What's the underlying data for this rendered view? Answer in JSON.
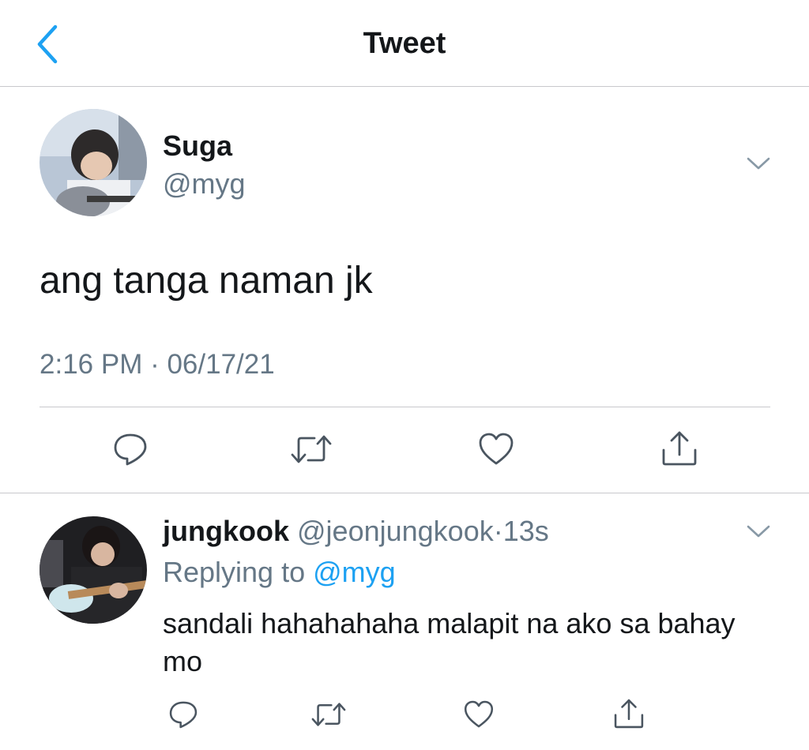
{
  "nav": {
    "title": "Tweet",
    "back_icon": "chevron-left-icon",
    "accent": "#1da1f2"
  },
  "tweet": {
    "author_name": "Suga",
    "author_handle": "@myg",
    "text": "ang tanga naman jk",
    "timestamp": "2:16 PM · 06/17/21",
    "actions": [
      "reply-icon",
      "retweet-icon",
      "like-icon",
      "share-icon"
    ]
  },
  "reply": {
    "author_name": "jungkook",
    "author_handle": "@jeonjungkook",
    "separator": "·",
    "time": "13s",
    "replying_label": "Replying to",
    "replying_handle": "@myg",
    "text": "sandali hahahahaha malapit na ako sa bahay mo",
    "actions": [
      "reply-icon",
      "retweet-icon",
      "like-icon",
      "share-icon"
    ]
  },
  "colors": {
    "text": "#14171a",
    "secondary": "#657786",
    "divider": "#c8c8cc",
    "icon": "#4a5560"
  }
}
